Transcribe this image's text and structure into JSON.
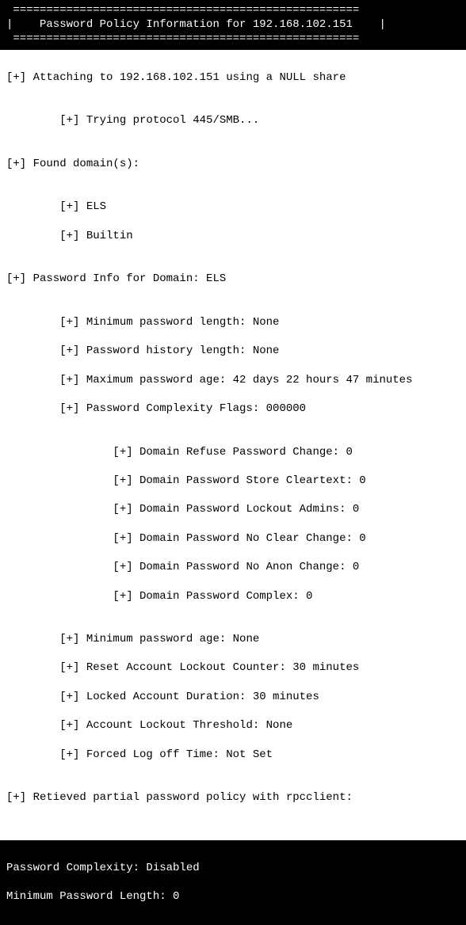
{
  "header": {
    "border": " ==================================================== ",
    "title": "|    Password Policy Information for 192.168.102.151    |"
  },
  "body": {
    "l01": "[+] Attaching to 192.168.102.151 using a NULL share",
    "l02": "",
    "l03": "        [+] Trying protocol 445/SMB...",
    "l04": "",
    "l05": "[+] Found domain(s):",
    "l06": "",
    "l07": "        [+] ELS",
    "l08": "        [+] Builtin",
    "l09": "",
    "l10": "[+] Password Info for Domain: ELS",
    "l11": "",
    "l12": "        [+] Minimum password length: None",
    "l13": "        [+] Password history length: None",
    "l14": "        [+] Maximum password age: 42 days 22 hours 47 minutes",
    "l15": "        [+] Password Complexity Flags: 000000",
    "l16": "",
    "l17": "                [+] Domain Refuse Password Change: 0",
    "l18": "                [+] Domain Password Store Cleartext: 0",
    "l19": "                [+] Domain Password Lockout Admins: 0",
    "l20": "                [+] Domain Password No Clear Change: 0",
    "l21": "                [+] Domain Password No Anon Change: 0",
    "l22": "                [+] Domain Password Complex: 0",
    "l23": "",
    "l24": "        [+] Minimum password age: None",
    "l25": "        [+] Reset Account Lockout Counter: 30 minutes",
    "l26": "        [+] Locked Account Duration: 30 minutes",
    "l27": "        [+] Account Lockout Threshold: None",
    "l28": "        [+] Forced Log off Time: Not Set",
    "l29": "",
    "l30": "[+] Retieved partial password policy with rpcclient:",
    "l31": ""
  },
  "footer": {
    "f1": "Password Complexity: Disabled",
    "f2": "Minimum Password Length: 0"
  }
}
